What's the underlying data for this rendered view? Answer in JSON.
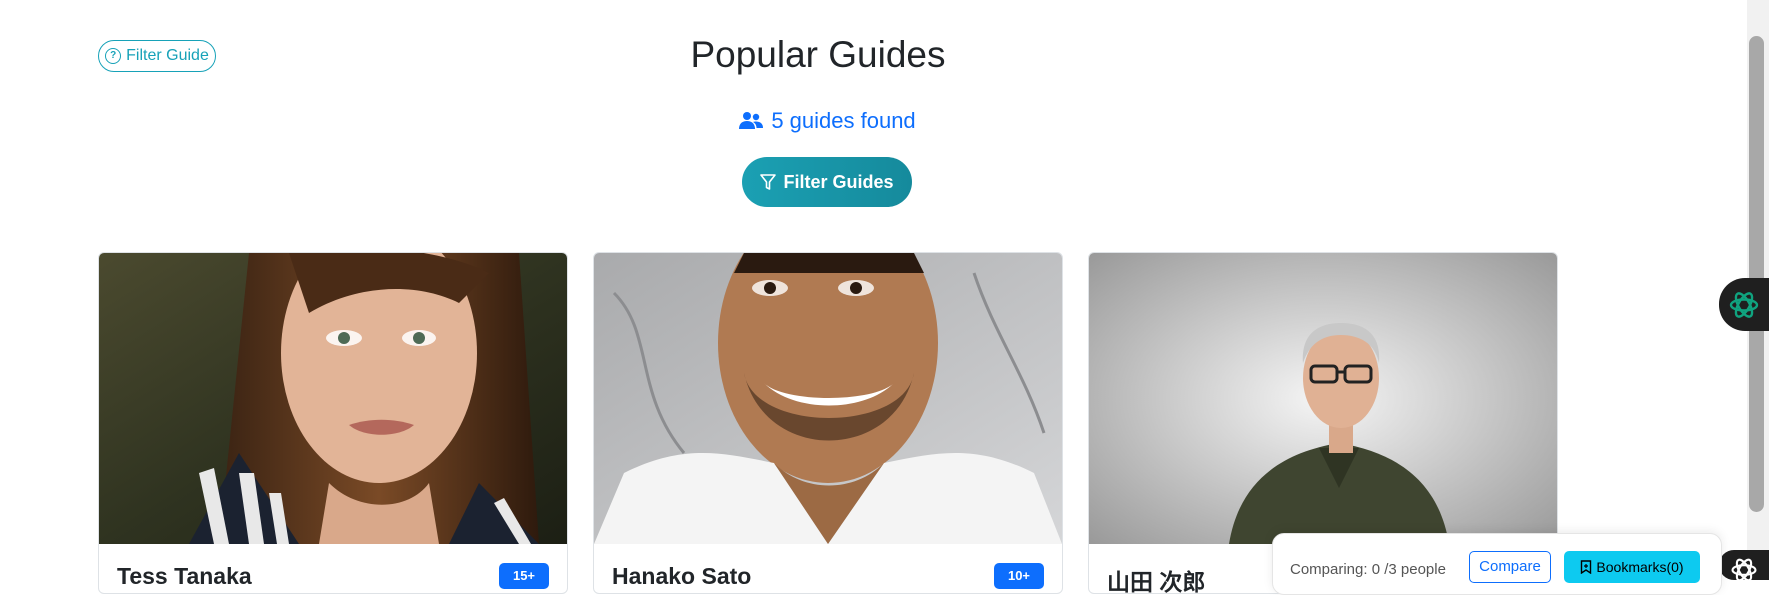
{
  "header": {
    "help_button_label": "Filter Guide",
    "title": "Popular Guides",
    "results_count": "5 guides found",
    "filter_button_label": "Filter Guides"
  },
  "guides": [
    {
      "name": "Tess Tanaka",
      "badge": "15+"
    },
    {
      "name": "Hanako Sato",
      "badge": "10+"
    },
    {
      "name": "山田 次郎",
      "badge": ""
    }
  ],
  "compare_bar": {
    "status_text": "Comparing: 0 /3 people",
    "compare_label": "Compare",
    "bookmarks_label": "Bookmarks(0)"
  },
  "colors": {
    "accent": "#17a2b8",
    "primary": "#0d6efd",
    "info": "#0dcaf0"
  }
}
